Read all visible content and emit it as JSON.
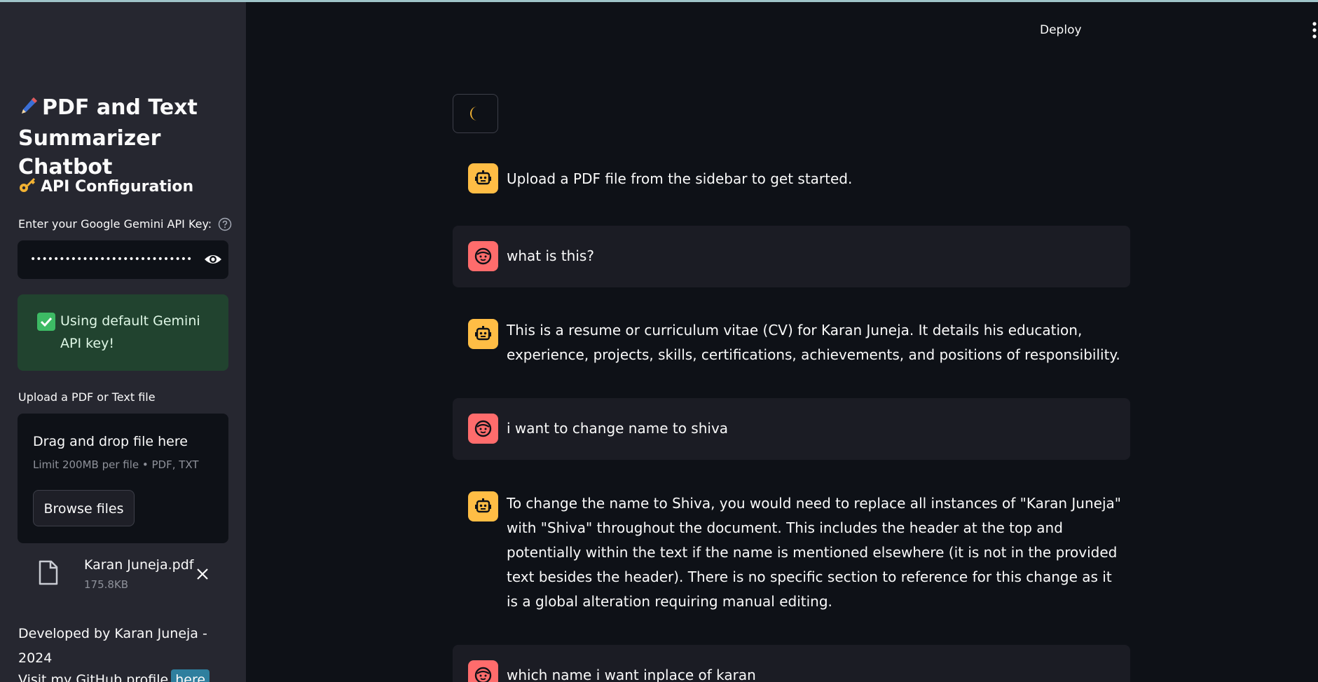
{
  "sidebar": {
    "app_title": "PDF and Text Summarizer Chatbot",
    "api_section_title": "API Configuration",
    "api_key_label": "Enter your Google Gemini API Key:",
    "api_key_value": "••••••••••••••••••••••••••••••••••••••••",
    "success_message": "Using default Gemini API key!",
    "upload_label": "Upload a PDF or Text file",
    "dropzone_title": "Drag and drop file here",
    "dropzone_limit": "Limit 200MB per file • PDF, TXT",
    "browse_label": "Browse files",
    "uploaded_file": {
      "name": "Karan Juneja.pdf",
      "size": "175.8KB"
    },
    "developer_text": "Developed by Karan Juneja - 2024",
    "github_text": "Visit my GitHub profile",
    "github_link": "here"
  },
  "header": {
    "deploy_label": "Deploy"
  },
  "chat": {
    "messages": [
      {
        "role": "assistant",
        "text": "Upload a PDF file from the sidebar to get started."
      },
      {
        "role": "user",
        "text": "what is this?"
      },
      {
        "role": "assistant",
        "text": "This is a resume or curriculum vitae (CV) for Karan Juneja. It details his education, experience, projects, skills, certifications, achievements, and positions of responsibility."
      },
      {
        "role": "user",
        "text": "i want to change name to shiva"
      },
      {
        "role": "assistant",
        "text": "To change the name to Shiva, you would need to replace all instances of \"Karan Juneja\" with \"Shiva\" throughout the document. This includes the header at the top and potentially within the text if the name is mentioned elsewhere (it is not in the provided text besides the header). There is no specific section to reference for this change as it is a global alteration requiring manual editing."
      },
      {
        "role": "user",
        "text": "which name i want inplace of karan"
      }
    ]
  },
  "colors": {
    "sidebar_bg": "#262730",
    "main_bg": "#0e1117",
    "bot_avatar": "#ffbd45",
    "user_avatar": "#ff6c6c",
    "success_bg": "#21432f",
    "link_bg": "#2e7f9e"
  },
  "icons": [
    "pen-icon",
    "key-icon",
    "help-icon",
    "eye-icon",
    "check-icon",
    "file-icon",
    "close-icon",
    "moon-icon",
    "robot-icon",
    "user-face-icon",
    "more-icon"
  ]
}
